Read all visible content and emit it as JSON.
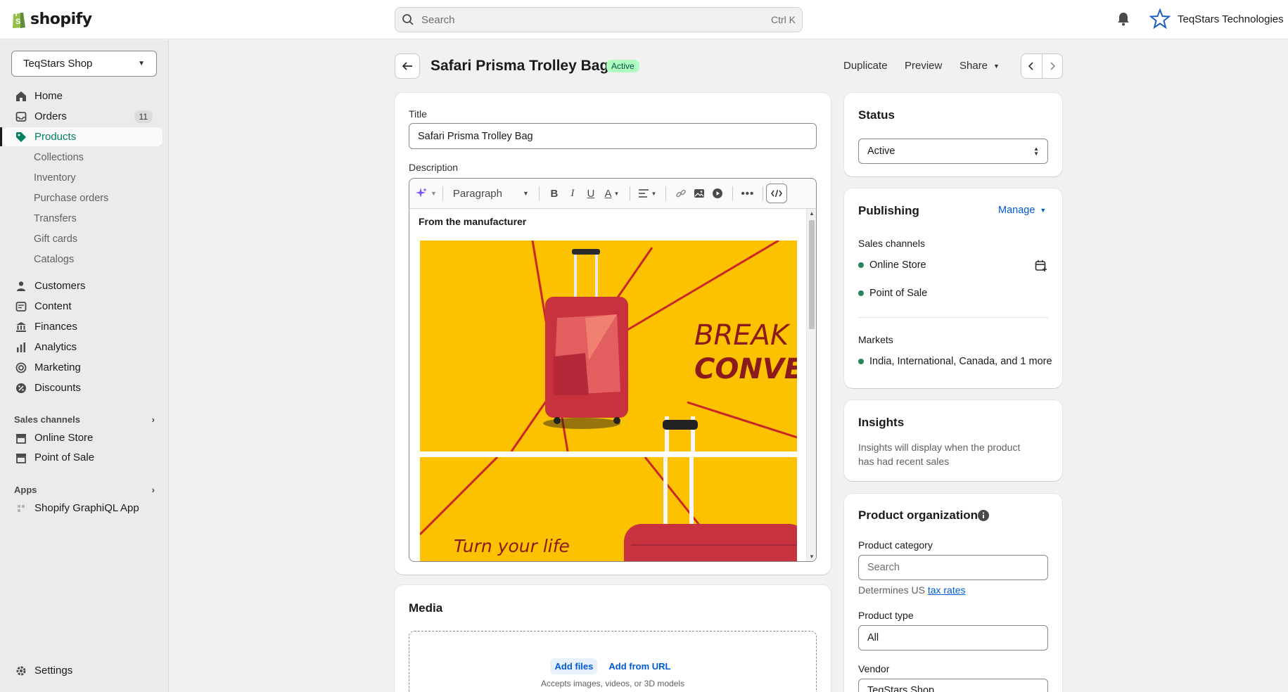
{
  "topbar": {
    "logo_text": "shopify",
    "search_placeholder": "Search",
    "search_shortcut": "Ctrl K",
    "store_name": "TeqStars Technologies"
  },
  "sidebar": {
    "shop_selector": "TeqStars Shop",
    "items": [
      {
        "label": "Home",
        "icon": "home-icon"
      },
      {
        "label": "Orders",
        "icon": "inbox-icon",
        "badge": "11"
      },
      {
        "label": "Products",
        "icon": "tag-icon",
        "active": true
      },
      {
        "label": "Collections"
      },
      {
        "label": "Inventory"
      },
      {
        "label": "Purchase orders"
      },
      {
        "label": "Transfers"
      },
      {
        "label": "Gift cards"
      },
      {
        "label": "Catalogs"
      },
      {
        "label": "Customers",
        "icon": "person-icon"
      },
      {
        "label": "Content",
        "icon": "content-icon"
      },
      {
        "label": "Finances",
        "icon": "bank-icon"
      },
      {
        "label": "Analytics",
        "icon": "chart-icon"
      },
      {
        "label": "Marketing",
        "icon": "target-icon"
      },
      {
        "label": "Discounts",
        "icon": "discount-icon"
      }
    ],
    "sales_channels_heading": "Sales channels",
    "sales_channels": [
      "Online Store",
      "Point of Sale"
    ],
    "apps_heading": "Apps",
    "apps": [
      "Shopify GraphiQL App"
    ],
    "settings": "Settings"
  },
  "header": {
    "title": "Safari Prisma Trolley Bag",
    "status_badge": "Active",
    "actions": {
      "duplicate": "Duplicate",
      "preview": "Preview",
      "share": "Share"
    }
  },
  "product": {
    "title_label": "Title",
    "title_value": "Safari Prisma Trolley Bag",
    "description_label": "Description",
    "paragraph_select": "Paragraph",
    "desc_heading": "From the manufacturer",
    "banner1_line1": "BREAK I",
    "banner1_line2": "CONVEN",
    "banner2_text": "Turn your life"
  },
  "media": {
    "title": "Media",
    "add_files": "Add files",
    "add_from_url": "Add from URL",
    "hint": "Accepts images, videos, or 3D models"
  },
  "status_card": {
    "title": "Status",
    "value": "Active"
  },
  "publishing": {
    "title": "Publishing",
    "manage": "Manage",
    "sales_channels_label": "Sales channels",
    "channels": [
      "Online Store",
      "Point of Sale"
    ],
    "markets_label": "Markets",
    "markets_value": "India, International, Canada, and 1 more"
  },
  "insights": {
    "title": "Insights",
    "text_line1": "Insights will display when the product",
    "text_line2": "has had recent sales"
  },
  "organization": {
    "title": "Product organization",
    "category_label": "Product category",
    "category_placeholder": "Search",
    "category_hint": "Determines US",
    "category_link": "tax rates",
    "type_label": "Product type",
    "type_value": "All",
    "vendor_label": "Vendor",
    "vendor_value": "TeqStars Shop"
  },
  "colors": {
    "accent": "#008060",
    "banner": "#fcc200",
    "bag": "#c8313e"
  }
}
